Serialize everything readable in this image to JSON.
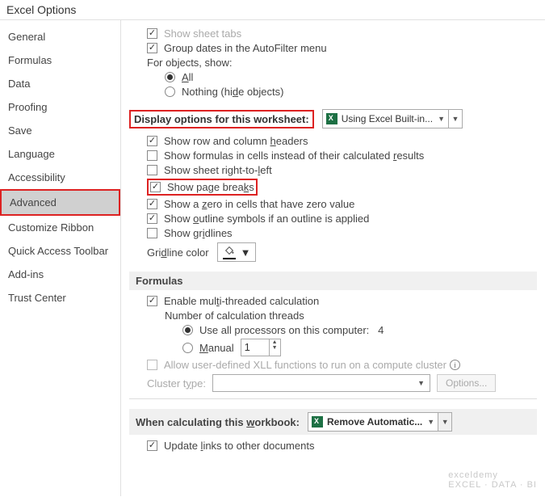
{
  "title": "Excel Options",
  "sidebar": {
    "items": [
      {
        "label": "General"
      },
      {
        "label": "Formulas"
      },
      {
        "label": "Data"
      },
      {
        "label": "Proofing"
      },
      {
        "label": "Save"
      },
      {
        "label": "Language"
      },
      {
        "label": "Accessibility"
      },
      {
        "label": "Advanced"
      },
      {
        "label": "Customize Ribbon"
      },
      {
        "label": "Quick Access Toolbar"
      },
      {
        "label": "Add-ins"
      },
      {
        "label": "Trust Center"
      }
    ],
    "selected": "Advanced"
  },
  "top": {
    "show_sheet_tabs": "Show sheet tabs",
    "group_dates": "Group dates in the AutoFilter menu",
    "for_objects": "For objects, show:",
    "opt_all": "All",
    "opt_nothing": "Nothing (hide objects)"
  },
  "worksheet_section": {
    "heading": "Display options for this worksheet:",
    "dropdown": "Using Excel Built-in...",
    "items": {
      "row_col_headers": "Show row and column headers",
      "formulas_in_cells": "Show formulas in cells instead of their calculated results",
      "sheet_rtl": "Show sheet right-to-left",
      "page_breaks": "Show page breaks",
      "zero_values": "Show a zero in cells that have zero value",
      "outline_symbols": "Show outline symbols if an outline is applied",
      "gridlines": "Show gridlines",
      "gridline_color": "Gridline color"
    }
  },
  "formulas_section": {
    "heading": "Formulas",
    "multi_thread": "Enable multi-threaded calculation",
    "num_threads": "Number of calculation threads",
    "use_all": "Use all processors on this computer:",
    "use_all_value": "4",
    "manual": "Manual",
    "manual_value": "1",
    "allow_xll": "Allow user-defined XLL functions to run on a compute cluster",
    "cluster_type": "Cluster type:",
    "options_btn": "Options..."
  },
  "calc_section": {
    "heading": "When calculating this workbook:",
    "dropdown": "Remove Automatic...",
    "update_links": "Update links to other documents"
  },
  "watermark": "EXCEL · DATA · BI"
}
